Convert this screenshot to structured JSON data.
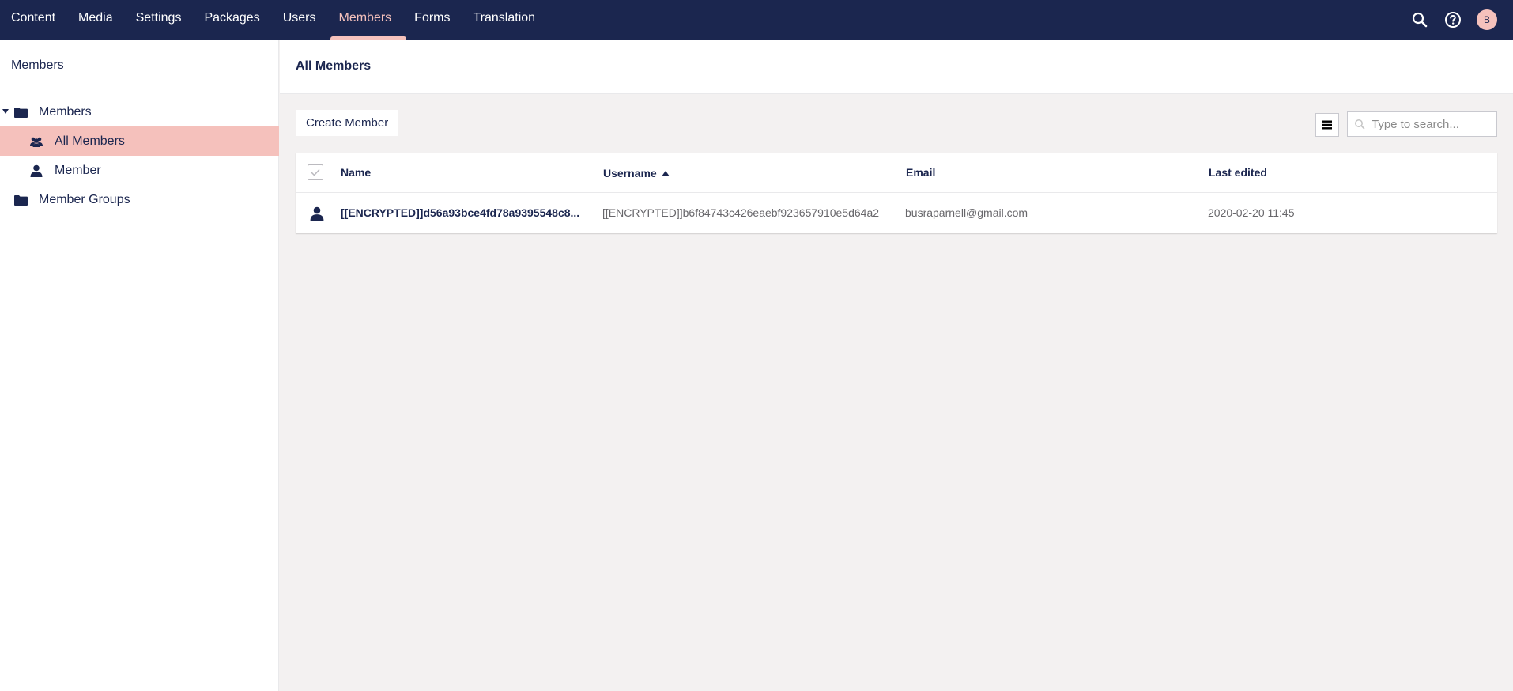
{
  "topnav": {
    "items": [
      {
        "label": "Content"
      },
      {
        "label": "Media"
      },
      {
        "label": "Settings"
      },
      {
        "label": "Packages"
      },
      {
        "label": "Users"
      },
      {
        "label": "Members"
      },
      {
        "label": "Forms"
      },
      {
        "label": "Translation"
      }
    ],
    "active_index": 5,
    "avatar_initial": "B"
  },
  "sidebar": {
    "title": "Members",
    "tree": [
      {
        "label": "Members",
        "icon": "folder-icon",
        "expanded": true
      },
      {
        "label": "All Members",
        "icon": "users-icon",
        "active": true
      },
      {
        "label": "Member",
        "icon": "user-icon"
      },
      {
        "label": "Member Groups",
        "icon": "folder-icon"
      }
    ]
  },
  "main": {
    "title": "All Members",
    "create_button": "Create Member",
    "search_placeholder": "Type to search...",
    "table": {
      "columns": {
        "name": "Name",
        "username": "Username",
        "email": "Email",
        "last_edited": "Last edited"
      },
      "sort_column": "username",
      "sort_direction": "ascending",
      "rows": [
        {
          "name": "[[ENCRYPTED]]d56a93bce4fd78a9395548c8...",
          "username": "[[ENCRYPTED]]b6f84743c426eaebf923657910e5d64a2",
          "email": "busraparnell@gmail.com",
          "last_edited": "2020-02-20 11:45"
        }
      ]
    }
  },
  "colors": {
    "header_bg": "#1b264f",
    "accent": "#f5c1bc",
    "page_bg": "#f3f1f1",
    "text": "#1b264f"
  }
}
